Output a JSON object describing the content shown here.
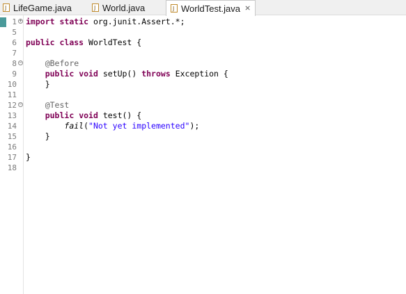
{
  "tabs": [
    {
      "label": "LifeGame.java",
      "active": false
    },
    {
      "label": "World.java",
      "active": false
    },
    {
      "label": "WorldTest.java",
      "active": true,
      "close_glyph": "⨯"
    }
  ],
  "editor": {
    "lines": [
      {
        "num": "1",
        "fold": "+",
        "parts": [
          {
            "t": "kw",
            "v": "import"
          },
          {
            "t": "p",
            "v": " "
          },
          {
            "t": "kw",
            "v": "static"
          },
          {
            "t": "p",
            "v": " org.junit.Assert.*;"
          }
        ]
      },
      {
        "num": "5",
        "parts": []
      },
      {
        "num": "6",
        "parts": [
          {
            "t": "kw",
            "v": "public"
          },
          {
            "t": "p",
            "v": " "
          },
          {
            "t": "kw",
            "v": "class"
          },
          {
            "t": "p",
            "v": " WorldTest {"
          }
        ]
      },
      {
        "num": "7",
        "parts": []
      },
      {
        "num": "8",
        "fold": "−",
        "parts": [
          {
            "t": "p",
            "v": "    "
          },
          {
            "t": "ann",
            "v": "@Before"
          }
        ]
      },
      {
        "num": "9",
        "parts": [
          {
            "t": "p",
            "v": "    "
          },
          {
            "t": "kw",
            "v": "public"
          },
          {
            "t": "p",
            "v": " "
          },
          {
            "t": "kw",
            "v": "void"
          },
          {
            "t": "p",
            "v": " setUp() "
          },
          {
            "t": "kw",
            "v": "throws"
          },
          {
            "t": "p",
            "v": " Exception {"
          }
        ]
      },
      {
        "num": "10",
        "parts": [
          {
            "t": "p",
            "v": "    }"
          }
        ]
      },
      {
        "num": "11",
        "parts": []
      },
      {
        "num": "12",
        "fold": "−",
        "parts": [
          {
            "t": "p",
            "v": "    "
          },
          {
            "t": "ann",
            "v": "@Test"
          }
        ]
      },
      {
        "num": "13",
        "parts": [
          {
            "t": "p",
            "v": "    "
          },
          {
            "t": "kw",
            "v": "public"
          },
          {
            "t": "p",
            "v": " "
          },
          {
            "t": "kw",
            "v": "void"
          },
          {
            "t": "p",
            "v": " test() {"
          }
        ]
      },
      {
        "num": "14",
        "parts": [
          {
            "t": "p",
            "v": "        "
          },
          {
            "t": "it",
            "v": "fail"
          },
          {
            "t": "p",
            "v": "("
          },
          {
            "t": "str",
            "v": "\"Not yet implemented\""
          },
          {
            "t": "p",
            "v": ");"
          }
        ]
      },
      {
        "num": "15",
        "parts": [
          {
            "t": "p",
            "v": "    }"
          }
        ]
      },
      {
        "num": "16",
        "parts": []
      },
      {
        "num": "17",
        "parts": [
          {
            "t": "p",
            "v": "}"
          }
        ]
      },
      {
        "num": "18",
        "parts": []
      }
    ]
  }
}
